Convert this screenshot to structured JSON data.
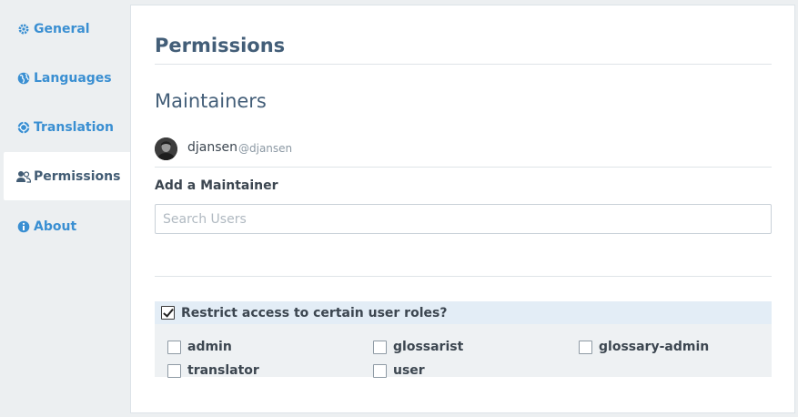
{
  "sidebar": {
    "items": [
      {
        "label": "General",
        "icon": "gear-icon"
      },
      {
        "label": "Languages",
        "icon": "globe-icon"
      },
      {
        "label": "Translation",
        "icon": "translation-icon"
      },
      {
        "label": "Permissions",
        "icon": "users-icon",
        "active": true
      },
      {
        "label": "About",
        "icon": "info-icon"
      }
    ]
  },
  "main": {
    "title": "Permissions",
    "maintainers_heading": "Maintainers",
    "maintainers": [
      {
        "name": "djansen",
        "handle": "@djansen"
      }
    ],
    "add_label": "Add a Maintainer",
    "search_placeholder": "Search Users",
    "restrict": {
      "label": "Restrict access to certain user roles?",
      "checked": true
    },
    "roles": [
      {
        "label": "admin",
        "checked": false
      },
      {
        "label": "glossarist",
        "checked": false
      },
      {
        "label": "glossary-admin",
        "checked": false
      },
      {
        "label": "translator",
        "checked": false
      },
      {
        "label": "user",
        "checked": false
      }
    ]
  },
  "colors": {
    "link": "#3a8fd2",
    "heading": "#435e78",
    "active_nav": "#425c74"
  }
}
